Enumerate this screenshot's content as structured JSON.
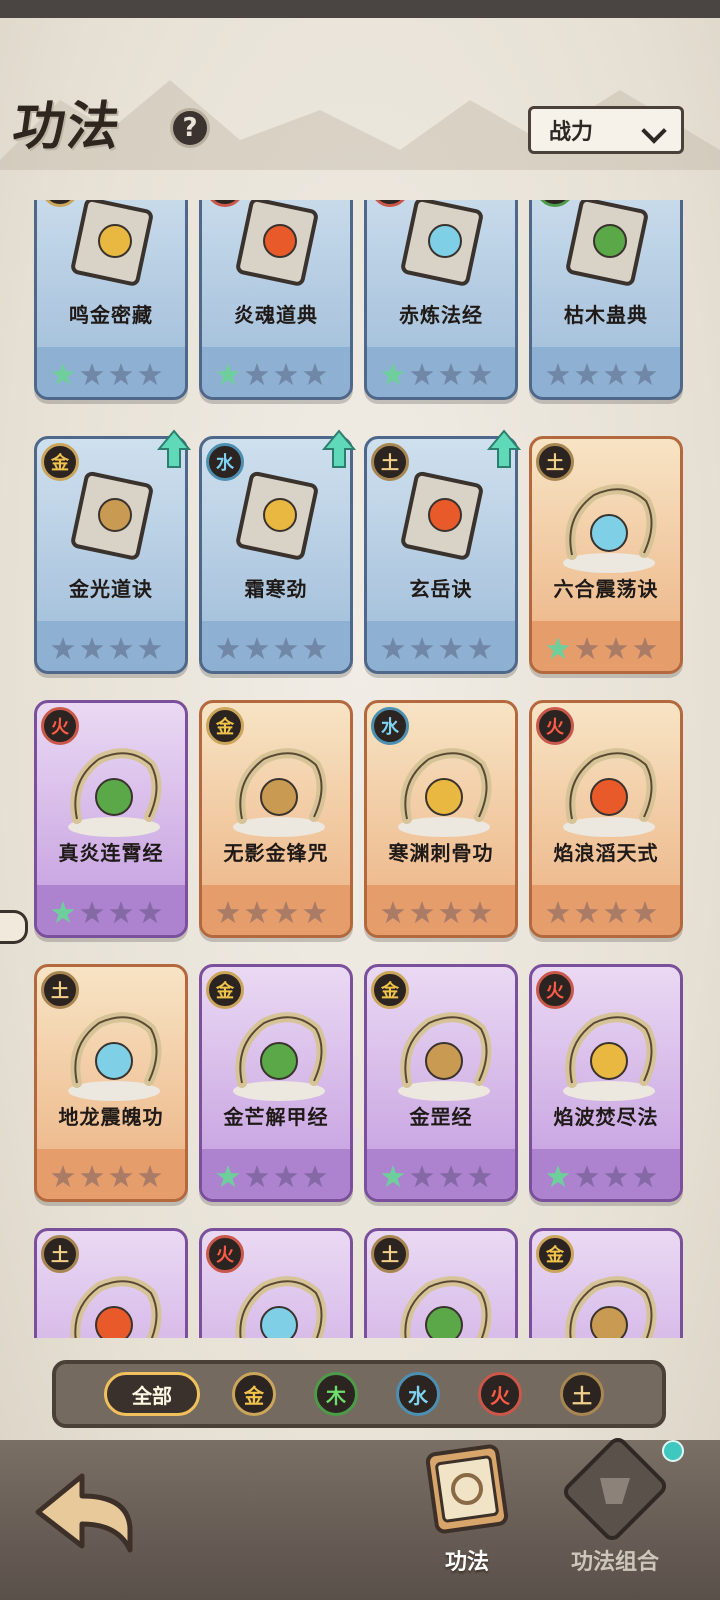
{
  "header": {
    "title": "功法",
    "help_icon": "question-icon",
    "sort_label": "战力"
  },
  "cards": [
    {
      "name": "鸣金密藏",
      "element": "金",
      "rarity": "blue",
      "stars_lit": 1,
      "upgrade": true
    },
    {
      "name": "炎魂道典",
      "element": "火",
      "rarity": "blue",
      "stars_lit": 1,
      "upgrade": true
    },
    {
      "name": "赤炼法经",
      "element": "火",
      "rarity": "blue",
      "stars_lit": 1,
      "upgrade": true
    },
    {
      "name": "枯木蛊典",
      "element": "木",
      "rarity": "blue",
      "stars_lit": 0,
      "upgrade": true
    },
    {
      "name": "金光道诀",
      "element": "金",
      "rarity": "blue",
      "stars_lit": 0,
      "upgrade": true
    },
    {
      "name": "霜寒劲",
      "element": "水",
      "rarity": "blue",
      "stars_lit": 0,
      "upgrade": true
    },
    {
      "name": "玄岳诀",
      "element": "土",
      "rarity": "blue",
      "stars_lit": 0,
      "upgrade": true
    },
    {
      "name": "六合震荡诀",
      "element": "土",
      "rarity": "orange",
      "stars_lit": 1,
      "upgrade": false
    },
    {
      "name": "真炎连霄经",
      "element": "火",
      "rarity": "purple",
      "stars_lit": 1,
      "upgrade": false
    },
    {
      "name": "无影金锋咒",
      "element": "金",
      "rarity": "orange",
      "stars_lit": 0,
      "upgrade": false
    },
    {
      "name": "寒渊刺骨功",
      "element": "水",
      "rarity": "orange",
      "stars_lit": 0,
      "upgrade": false
    },
    {
      "name": "焰浪滔天式",
      "element": "火",
      "rarity": "orange",
      "stars_lit": 0,
      "upgrade": false
    },
    {
      "name": "地龙震魄功",
      "element": "土",
      "rarity": "orange",
      "stars_lit": 0,
      "upgrade": false
    },
    {
      "name": "金芒解甲经",
      "element": "金",
      "rarity": "purple",
      "stars_lit": 1,
      "upgrade": false
    },
    {
      "name": "金罡经",
      "element": "金",
      "rarity": "purple",
      "stars_lit": 1,
      "upgrade": false
    },
    {
      "name": "焰波焚尽法",
      "element": "火",
      "rarity": "purple",
      "stars_lit": 1,
      "upgrade": false
    },
    {
      "name": "",
      "element": "土",
      "rarity": "purple",
      "stars_lit": 0,
      "upgrade": false
    },
    {
      "name": "",
      "element": "火",
      "rarity": "purple",
      "stars_lit": 0,
      "upgrade": false
    },
    {
      "name": "",
      "element": "土",
      "rarity": "purple",
      "stars_lit": 0,
      "upgrade": false
    },
    {
      "name": "",
      "element": "金",
      "rarity": "purple",
      "stars_lit": 0,
      "upgrade": false
    }
  ],
  "filters": {
    "all": "全部",
    "metal": "金",
    "wood": "木",
    "water": "水",
    "fire": "火",
    "earth": "土"
  },
  "nav": {
    "tab_gongfa": "功法",
    "tab_combo": "功法组合"
  },
  "colors": {
    "metal": "#f0c44c",
    "wood": "#6ede6a",
    "water": "#7fd3f2",
    "fire": "#ff5b46",
    "earth": "#f2cf8a"
  }
}
